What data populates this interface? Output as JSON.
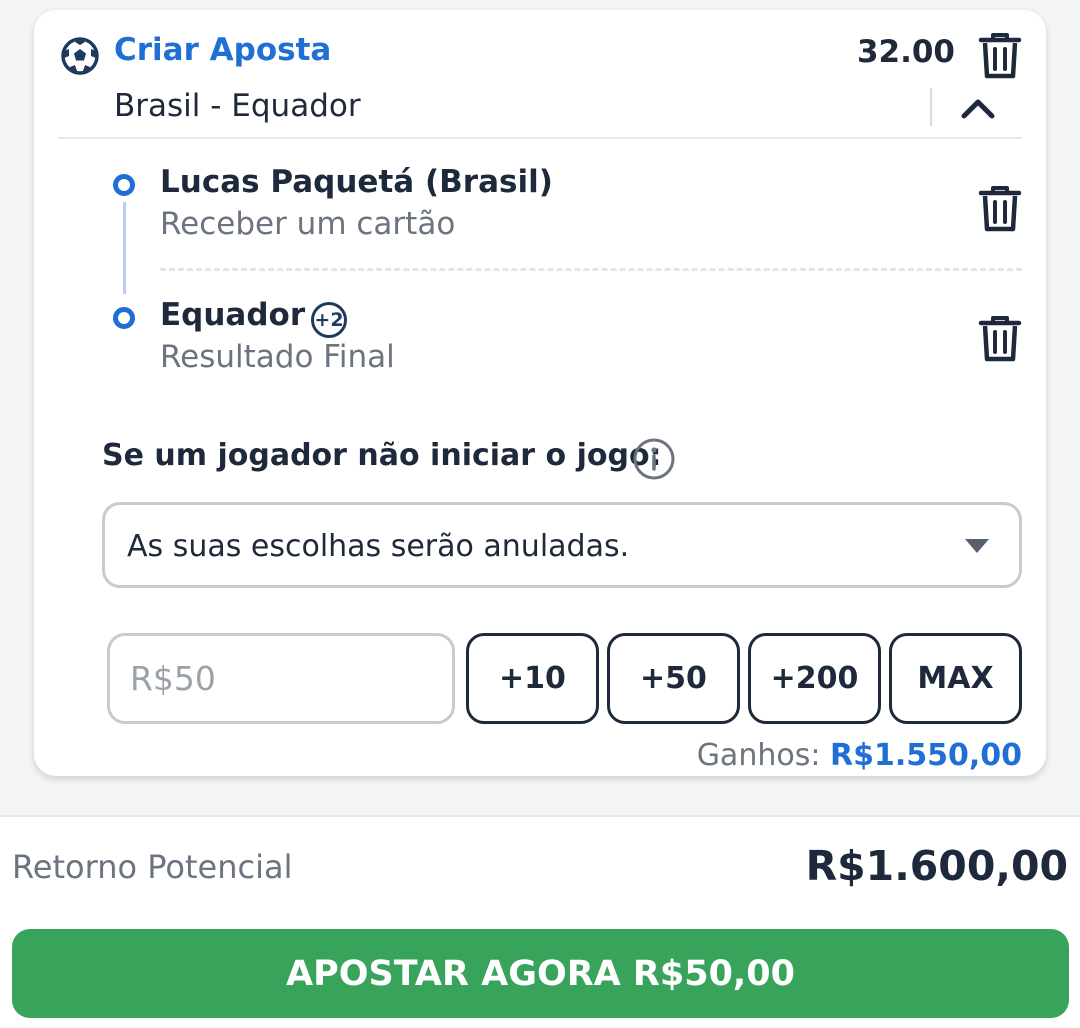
{
  "bet": {
    "title": "Criar Aposta",
    "odds": "32.00",
    "match": "Brasil - Equador",
    "selections": [
      {
        "title": "Lucas Paquetá (Brasil)",
        "market": "Receber um cartão"
      },
      {
        "title": "Equador",
        "badge": "+2",
        "market": "Resultado Final"
      }
    ],
    "question": "Se um jogador não iniciar o jogo:",
    "dropdown": {
      "selected": "As suas escolhas serão anuladas."
    },
    "stake": {
      "placeholder": "R$50"
    },
    "quick_amounts": [
      "+10",
      "+50",
      "+200",
      "MAX"
    ],
    "winnings": {
      "label": "Ganhos:",
      "amount": "R$1.550,00"
    }
  },
  "footer": {
    "return_label": "Retorno Potencial",
    "return_value": "R$1.600,00",
    "cta": "APOSTAR AGORA R$50,00"
  },
  "colors": {
    "accent": "#1f6fd4",
    "cta": "#37a35b",
    "text": "#1e293b",
    "muted": "#6b7480"
  },
  "icons": [
    "soccer-ball-icon",
    "trash-icon",
    "chevron-up-icon",
    "info-icon",
    "dropdown-arrow-icon"
  ]
}
